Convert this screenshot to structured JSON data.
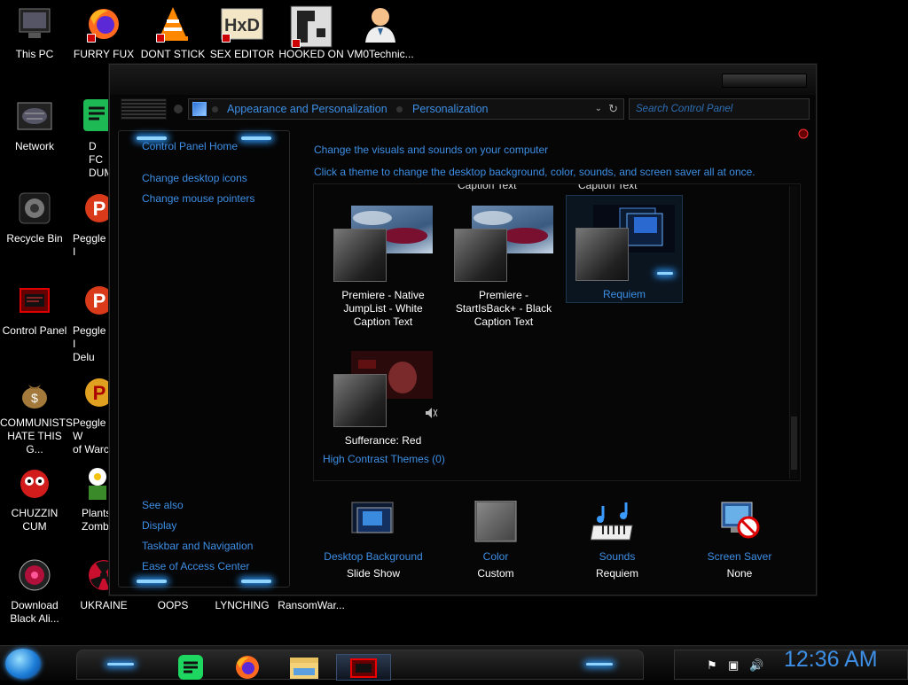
{
  "desktop": {
    "icons": [
      {
        "label": "This PC",
        "icon": "computer-icon"
      },
      {
        "label": "FURRY FUX",
        "icon": "firefox-icon"
      },
      {
        "label": "DONT STICK",
        "icon": "vlc-icon"
      },
      {
        "label": "SEX EDITOR",
        "icon": "hxd-icon"
      },
      {
        "label": "HOOKED ON",
        "icon": "app-icon"
      },
      {
        "label": "VM0Technic...",
        "icon": "doctor-icon"
      },
      {
        "label": "Network",
        "icon": "network-icon"
      },
      {
        "label": "D FC\nDUMB",
        "icon": "green-app-icon"
      },
      {
        "label": "Recycle Bin",
        "icon": "recycle-bin-icon"
      },
      {
        "label": "Peggle I",
        "icon": "peggle-icon"
      },
      {
        "label": "Control Panel",
        "icon": "control-panel-icon"
      },
      {
        "label": "Peggle I\nDelu",
        "icon": "peggle-icon"
      },
      {
        "label": "COMMUNISTS\nHATE THIS G...",
        "icon": "money-bag-icon"
      },
      {
        "label": "Peggle W\nof Warc",
        "icon": "peggle-icon"
      },
      {
        "label": "CHUZZIN\nCUM",
        "icon": "chuzzle-icon"
      },
      {
        "label": "Plants\nZomb",
        "icon": "plants-icon"
      },
      {
        "label": "Download\nBlack Ali...",
        "icon": "black-ali-icon"
      },
      {
        "label": "UKRAINE",
        "icon": "radiation-icon"
      },
      {
        "label": "OOPS",
        "icon": "blank-icon"
      },
      {
        "label": "LYNCHING",
        "icon": "blank-icon"
      },
      {
        "label": "RansomWar...",
        "icon": "blank-icon"
      }
    ]
  },
  "window": {
    "address": {
      "segments": [
        "Appearance and Personalization",
        "Personalization"
      ],
      "dropdown_glyph": "⌄",
      "refresh_glyph": "↻"
    },
    "search": {
      "placeholder": "Search Control Panel"
    },
    "sidebar": {
      "home": "Control Panel Home",
      "links": [
        "Change desktop icons",
        "Change mouse pointers"
      ],
      "see_also_header": "See also",
      "see_also": [
        "Display",
        "Taskbar and Navigation",
        "Ease of Access Center"
      ]
    },
    "main": {
      "heading": "Change the visuals and sounds on your computer",
      "subheading": "Click a theme to change the desktop background, color, sounds, and screen saver all at once.",
      "cut_captions": [
        "Caption Text",
        "Caption Text"
      ],
      "themes": [
        {
          "name": "Premiere - Native\nJumpList - White\nCaption Text",
          "selected": false
        },
        {
          "name": "Premiere -\nStartIsBack+ - Black\nCaption Text",
          "selected": false
        },
        {
          "name": "Requiem",
          "selected": true
        },
        {
          "name": "Sufferance: Red",
          "selected": false
        }
      ],
      "high_contrast": "High Contrast Themes (0)",
      "bottom": [
        {
          "link": "Desktop Background",
          "value": "Slide Show",
          "icon": "desktop-background-icon"
        },
        {
          "link": "Color",
          "value": "Custom",
          "icon": "color-icon"
        },
        {
          "link": "Sounds",
          "value": "Requiem",
          "icon": "sounds-icon"
        },
        {
          "link": "Screen Saver",
          "value": "None",
          "icon": "screen-saver-icon"
        }
      ]
    }
  },
  "taskbar": {
    "apps": [
      "sheets-icon",
      "firefox-icon",
      "file-explorer-icon",
      "control-panel-icon"
    ],
    "tray_icons": [
      "flag-icon",
      "network-icon",
      "volume-icon"
    ],
    "tray_glyphs": [
      "⚑",
      "▣",
      "🔊"
    ],
    "clock": "12:36 AM"
  },
  "colors": {
    "accent": "#3d8fe6",
    "glow": "#8fd4ff"
  }
}
